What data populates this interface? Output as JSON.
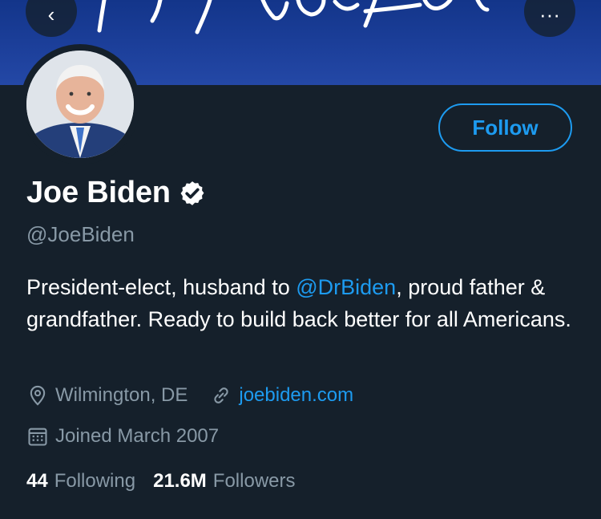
{
  "profile": {
    "display_name": "Joe Biden",
    "handle": "@JoeBiden",
    "verified": true,
    "bio_before": "President-elect, husband to ",
    "bio_mention": "@DrBiden",
    "bio_after": ", proud father & grandfather. Ready to build back better for all Americans.",
    "location": "Wilmington, DE",
    "website": "joebiden.com",
    "joined": "Joined March 2007"
  },
  "actions": {
    "follow_label": "Follow",
    "back_glyph": "‹",
    "more_glyph": "···"
  },
  "stats": {
    "following_count": "44",
    "following_label": "Following",
    "followers_count": "21.6M",
    "followers_label": "Followers"
  },
  "icons": {
    "back": "back-arrow-icon",
    "more": "more-options-icon",
    "verified": "verified-badge-icon",
    "location": "location-pin-icon",
    "link": "link-icon",
    "calendar": "calendar-icon"
  },
  "colors": {
    "background": "#15202b",
    "accent": "#1d9bf0",
    "secondary_text": "#8899a6",
    "banner": "#1c3f9a"
  }
}
